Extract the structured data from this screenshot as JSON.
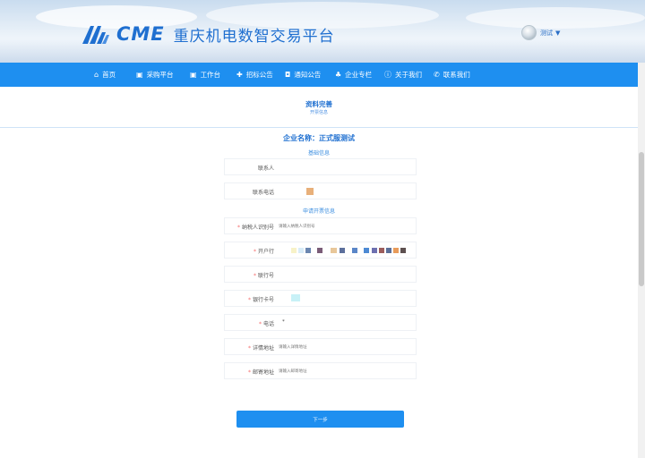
{
  "brand": {
    "abbr": "CME",
    "name": "重庆机电数智交易平台",
    "primary_color": "#1f6fd0"
  },
  "user": {
    "name": "测试",
    "caret": "▼"
  },
  "nav": {
    "color": "#1e8ff0",
    "items": [
      {
        "label": "首页",
        "icon": "home-icon",
        "glyph": "⌂"
      },
      {
        "label": "采购平台",
        "icon": "monitor-icon",
        "glyph": "▣"
      },
      {
        "label": "工作台",
        "icon": "desktop-icon",
        "glyph": "▣"
      },
      {
        "label": "招标公告",
        "icon": "plus-circle-icon",
        "glyph": "✚"
      },
      {
        "label": "通知公告",
        "icon": "bell-icon",
        "glyph": "◘"
      },
      {
        "label": "企业专栏",
        "icon": "users-icon",
        "glyph": "♣"
      },
      {
        "label": "关于我们",
        "icon": "info-icon",
        "glyph": "ⓘ"
      },
      {
        "label": "联系我们",
        "icon": "phone-icon",
        "glyph": "✆"
      }
    ]
  },
  "page": {
    "title": "资料完善",
    "subtitle": "开票信息"
  },
  "company": {
    "label": "企业名称：",
    "value": "正式服测试"
  },
  "basic": {
    "title": "基础信息",
    "contact_label": "联系人",
    "phone_label": "联系电话"
  },
  "invoice": {
    "title": "申请开票信息",
    "fields": [
      {
        "label": "纳税人识别号",
        "required": true,
        "placeholder": "请输入纳税人识别号"
      },
      {
        "label": "开户行",
        "required": true,
        "placeholder": ""
      },
      {
        "label": "联行号",
        "required": true,
        "placeholder": ""
      },
      {
        "label": "银行卡号",
        "required": true,
        "placeholder": ""
      },
      {
        "label": "电话",
        "required": true,
        "value": "*"
      },
      {
        "label": "详情地址",
        "required": true,
        "placeholder": "请输入详情地址"
      },
      {
        "label": "邮寄地址",
        "required": true,
        "placeholder": "请输入邮寄地址"
      }
    ]
  },
  "actions": {
    "next_label": "下一步"
  }
}
